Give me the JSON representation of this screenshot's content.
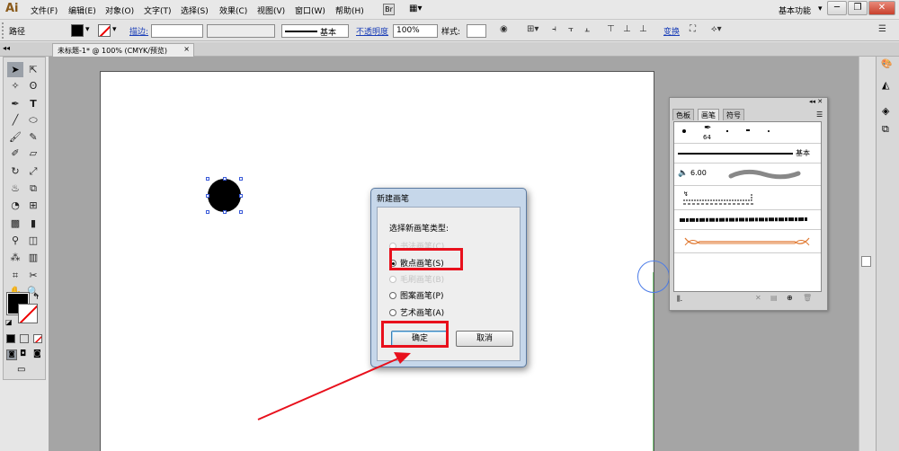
{
  "app": {
    "logo": "Ai"
  },
  "menu": [
    "文件(F)",
    "编辑(E)",
    "对象(O)",
    "文字(T)",
    "选择(S)",
    "效果(C)",
    "视图(V)",
    "窗口(W)",
    "帮助(H)"
  ],
  "workspace": "基本功能",
  "control_bar": {
    "object_type": "路径",
    "stroke_label": "描边:",
    "stroke_style": "基本",
    "opacity_label": "不透明度",
    "opacity_value": "100%",
    "style_label": "样式:",
    "transform_label": "变换"
  },
  "document_tab": {
    "title": "未标题-1* @ 100% (CMYK/预览)",
    "close": "×"
  },
  "brush_panel": {
    "tabs": [
      "色板",
      "画笔",
      "符号"
    ],
    "active_tab": "画笔",
    "brush_size_label": "64",
    "basic_label": "基本",
    "size_readout": "6.00"
  },
  "dialog": {
    "title": "新建画笔",
    "prompt": "选择新画笔类型:",
    "options": [
      {
        "label": "书法画笔(C)",
        "enabled": false,
        "selected": false
      },
      {
        "label": "散点画笔(S)",
        "enabled": true,
        "selected": true
      },
      {
        "label": "毛刷画笔(B)",
        "enabled": false,
        "selected": false
      },
      {
        "label": "图案画笔(P)",
        "enabled": true,
        "selected": false
      },
      {
        "label": "艺术画笔(A)",
        "enabled": true,
        "selected": false
      }
    ],
    "ok_label": "确定",
    "cancel_label": "取消"
  },
  "colors": {
    "annotation_red": "#e8101c",
    "selection_blue": "#3a5ad8",
    "dialog_bg": "#c6d7ea",
    "fill_color": "#000000"
  },
  "icons": [
    "selection-arrow-icon",
    "direct-select-icon",
    "magic-wand-icon",
    "lasso-icon",
    "pen-icon",
    "type-icon",
    "line-icon",
    "ellipse-icon",
    "paintbrush-icon",
    "pencil-icon",
    "blob-brush-icon",
    "eraser-icon",
    "rotate-icon",
    "scale-icon",
    "warp-icon",
    "free-transform-icon",
    "shape-builder-icon",
    "perspective-grid-icon",
    "mesh-icon",
    "gradient-icon",
    "eyedropper-icon",
    "blend-icon",
    "symbol-sprayer-icon",
    "column-graph-icon",
    "artboard-icon",
    "slice-icon",
    "hand-icon",
    "zoom-icon"
  ]
}
